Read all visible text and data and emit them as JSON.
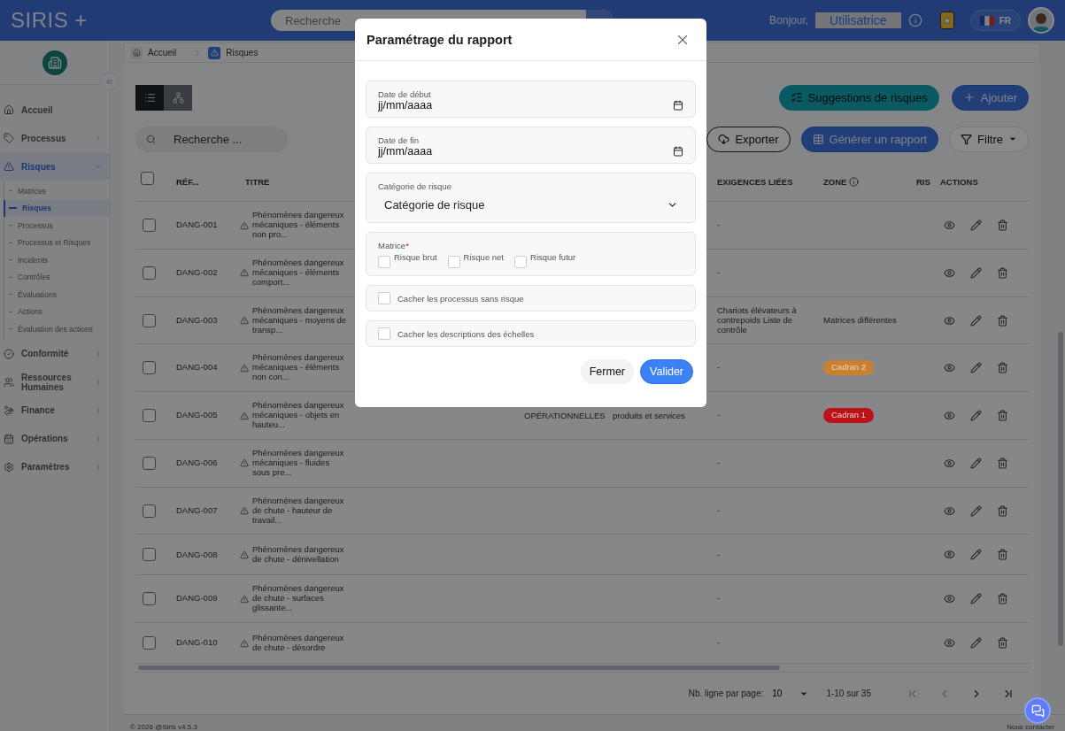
{
  "header": {
    "logo": "SIRIS +",
    "search": {
      "placeholder": "Recherche"
    },
    "greeting": "Bonjour,",
    "user": "Utilisatrice",
    "language": "FR"
  },
  "sidebar": {
    "items": [
      {
        "label": "Accueil",
        "kind": "link",
        "selected": false
      },
      {
        "label": "Processus",
        "kind": "group",
        "selected": false,
        "expanded": false
      },
      {
        "label": "Risques",
        "kind": "group",
        "selected": true,
        "expanded": true,
        "children": [
          {
            "label": "Matrices",
            "selected": false
          },
          {
            "label": "Risques",
            "selected": true
          },
          {
            "label": "Processus",
            "selected": false
          },
          {
            "label": "Processus et Risques",
            "selected": false
          },
          {
            "label": "Incidents",
            "selected": false
          },
          {
            "label": "Contrôles",
            "selected": false
          },
          {
            "label": "Évaluations",
            "selected": false
          },
          {
            "label": "Actions",
            "selected": false
          },
          {
            "label": "Évaluation des actions",
            "selected": false
          }
        ]
      },
      {
        "label": "Conformité",
        "kind": "group",
        "selected": false,
        "expanded": false
      },
      {
        "label": "Ressources Humaines",
        "kind": "group",
        "selected": false,
        "expanded": false
      },
      {
        "label": "Finance",
        "kind": "group",
        "selected": false,
        "expanded": false
      },
      {
        "label": "Opérations",
        "kind": "group",
        "selected": false,
        "expanded": false
      },
      {
        "label": "Paramètres",
        "kind": "group",
        "selected": false,
        "expanded": false
      }
    ]
  },
  "breadcrumb": [
    {
      "label": "Accueil",
      "selected": false
    },
    {
      "label": "Risques",
      "selected": true
    }
  ],
  "toolbar": {
    "views": [
      {
        "kind": "list",
        "selected": true
      },
      {
        "kind": "tree",
        "selected": false
      }
    ],
    "search": {
      "placeholder": "Recherche ..."
    },
    "top_buttons": [
      {
        "kind": "suggest",
        "label": "Suggestions de risques"
      },
      {
        "kind": "add",
        "label": "Ajouter"
      }
    ],
    "buttons": [
      {
        "kind": "export",
        "label": "Exporter"
      },
      {
        "kind": "report",
        "label": "Générer un rapport"
      },
      {
        "kind": "filter",
        "label": "Filtre"
      }
    ]
  },
  "table": {
    "all_checked": false,
    "headings": {
      "ref": "RÉF...",
      "title": "TITRE",
      "requirements": "EXIGENCES LIÉES",
      "zone": "ZONE",
      "column_8": "RIS",
      "actions": "ACTIONS"
    },
    "rows": [
      {
        "checked": false,
        "ref": "DANG-001",
        "title": "Phénomènes dangereux mécaniques - éléments non pro...",
        "requirements": "-"
      },
      {
        "checked": false,
        "ref": "DANG-002",
        "title": "Phénomènes dangereux mécaniques - éléments comport...",
        "requirements": "-"
      },
      {
        "checked": false,
        "ref": "DANG-003",
        "title": "Phénomènes dangereux mécaniques - moyens de transp...",
        "requirements": "Chariots élévateurs à contrepoids Liste de contrôle",
        "zone": {
          "kind": "text",
          "label": "Matrices différentes"
        }
      },
      {
        "checked": false,
        "ref": "DANG-004",
        "title": "Phénomènes dangereux mécaniques - éléments non con...",
        "requirements": "-",
        "zone": {
          "kind": "badge",
          "label": "Cadran 2",
          "color": "#c8812f"
        }
      },
      {
        "checked": false,
        "ref": "DANG-005",
        "title": "Phénomènes dangereux mécaniques - objets en hauteu...",
        "column_3": "OPÉRATIONNELLES",
        "column_4": "produits et services",
        "requirements": "-",
        "zone": {
          "kind": "badge",
          "label": "Cadran 1",
          "color": "#bd121b"
        }
      },
      {
        "checked": false,
        "ref": "DANG-006",
        "title": "Phénomènes dangereux mécaniques - fluides sous pre...",
        "requirements": "-"
      },
      {
        "checked": false,
        "ref": "DANG-007",
        "title": "Phénomènes dangereux de chute - hauteur de travail...",
        "requirements": "-"
      },
      {
        "checked": false,
        "ref": "DANG-008",
        "title": "Phénomènes dangereux de chute - dénivellation",
        "requirements": "-"
      },
      {
        "checked": false,
        "ref": "DANG-009",
        "title": "Phénomènes dangereux de chute - surfaces glissante...",
        "requirements": "-"
      },
      {
        "checked": false,
        "ref": "DANG-010",
        "title": "Phénomènes dangereux de chute - désordre",
        "requirements": "-"
      }
    ]
  },
  "pagination": {
    "rows_per_page_label": "Nb. ligne par page:",
    "rows_per_page": "10",
    "range": "1-10 sur 35",
    "buttons": [
      {
        "kind": "first",
        "disabled": true
      },
      {
        "kind": "prev",
        "disabled": true
      },
      {
        "kind": "next",
        "disabled": false
      },
      {
        "kind": "last",
        "disabled": false
      }
    ]
  },
  "footer": {
    "copyright": "© 2026 @Siris v4.5.3",
    "contact": "Nous contacter"
  },
  "modal": {
    "title": "Paramétrage du rapport",
    "fields": [
      {
        "kind": "date",
        "label": "Date de début",
        "placeholder": "jj/mm/aaaa"
      },
      {
        "kind": "date",
        "label": "Date de fin",
        "placeholder": "jj/mm/aaaa"
      },
      {
        "kind": "select",
        "label": "Catégorie de risque",
        "value": "Catégorie de risque"
      },
      {
        "kind": "checkgroup",
        "label": "Matrice",
        "required_mark": "*",
        "options": [
          {
            "label": "Risque brut",
            "checked": false
          },
          {
            "label": "Risque net",
            "checked": false
          },
          {
            "label": "Risque futur",
            "checked": false
          }
        ]
      },
      {
        "kind": "checkbox",
        "label": "Cacher les processus sans risque",
        "checked": false
      },
      {
        "kind": "checkbox",
        "label": "Cacher les descriptions des échelles",
        "checked": false
      }
    ],
    "buttons": [
      {
        "kind": "secondary",
        "label": "Fermer"
      },
      {
        "kind": "primary",
        "label": "Valider"
      }
    ]
  }
}
